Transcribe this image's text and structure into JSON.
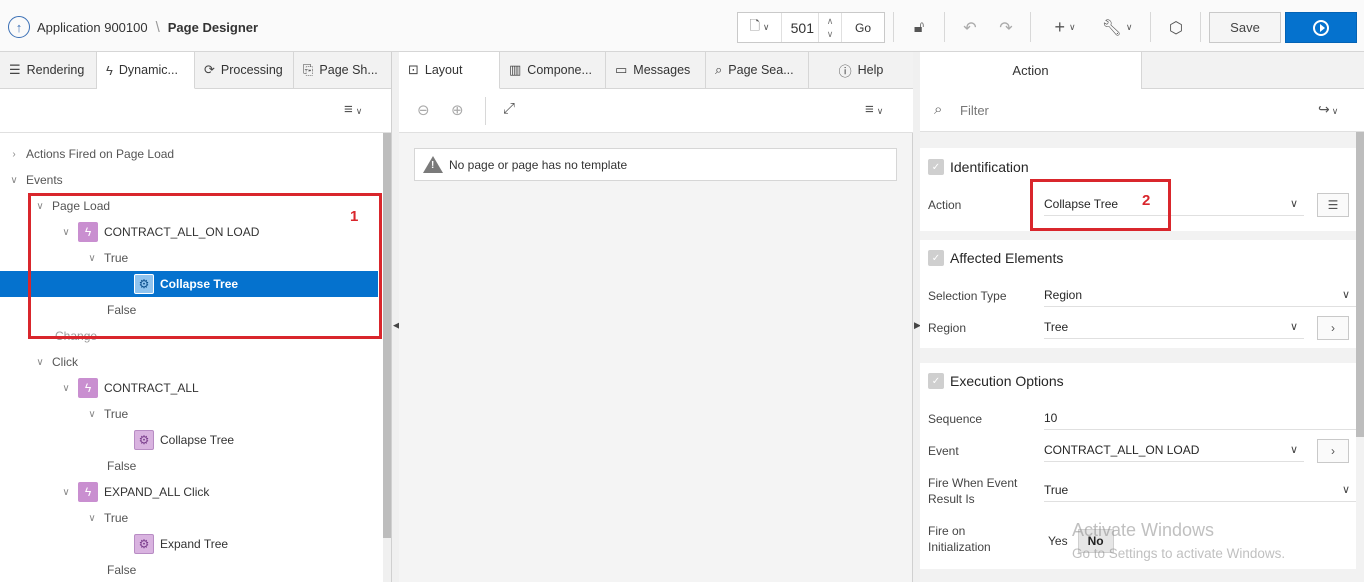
{
  "header": {
    "app_label": "Application 900100",
    "page_label": "Page Designer",
    "page_number": "501",
    "go_label": "Go",
    "save_label": "Save"
  },
  "left_tabs": [
    {
      "label": "Rendering",
      "icon": "list-icon"
    },
    {
      "label": "Dynamic...",
      "icon": "lightning-icon"
    },
    {
      "label": "Processing",
      "icon": "refresh-icon"
    },
    {
      "label": "Page Sh...",
      "icon": "share-icon"
    }
  ],
  "tree": {
    "actions_on_load": "Actions Fired on Page Load",
    "events": "Events",
    "page_load": "Page Load",
    "da1": "CONTRACT_ALL_ON LOAD",
    "true1": "True",
    "act1": "Collapse Tree",
    "false1": "False",
    "change": "Change",
    "click": "Click",
    "da2": "CONTRACT_ALL",
    "true2": "True",
    "act2": "Collapse Tree",
    "false2": "False",
    "da3": "EXPAND_ALL Click",
    "true3": "True",
    "act3": "Expand Tree",
    "false3": "False"
  },
  "annotations": {
    "one": "1",
    "two": "2"
  },
  "mid_tabs": [
    {
      "label": "Layout"
    },
    {
      "label": "Compone..."
    },
    {
      "label": "Messages"
    },
    {
      "label": "Page Sea..."
    },
    {
      "label": "Help"
    }
  ],
  "mid": {
    "no_template_msg": "No page or page has no template"
  },
  "right": {
    "tab_label": "Action",
    "filter_placeholder": "Filter",
    "identification": {
      "heading": "Identification",
      "action_label": "Action",
      "action_value": "Collapse Tree"
    },
    "affected": {
      "heading": "Affected Elements",
      "selection_type_label": "Selection Type",
      "selection_type_value": "Region",
      "region_label": "Region",
      "region_value": "Tree"
    },
    "execution": {
      "heading": "Execution Options",
      "sequence_label": "Sequence",
      "sequence_value": "10",
      "event_label": "Event",
      "event_value": "CONTRACT_ALL_ON LOAD",
      "fire_when_label_1": "Fire When Event",
      "fire_when_label_2": "Result Is",
      "fire_when_value": "True",
      "fire_init_label_1": "Fire on",
      "fire_init_label_2": "Initialization",
      "yes": "Yes",
      "no": "No"
    }
  },
  "watermark": {
    "line1": "Activate Windows",
    "line2": "Go to Settings to activate Windows."
  },
  "colors": {
    "accent": "#0572ce",
    "annotation": "#d9262c",
    "dynamic_action": "#c98fd0"
  }
}
